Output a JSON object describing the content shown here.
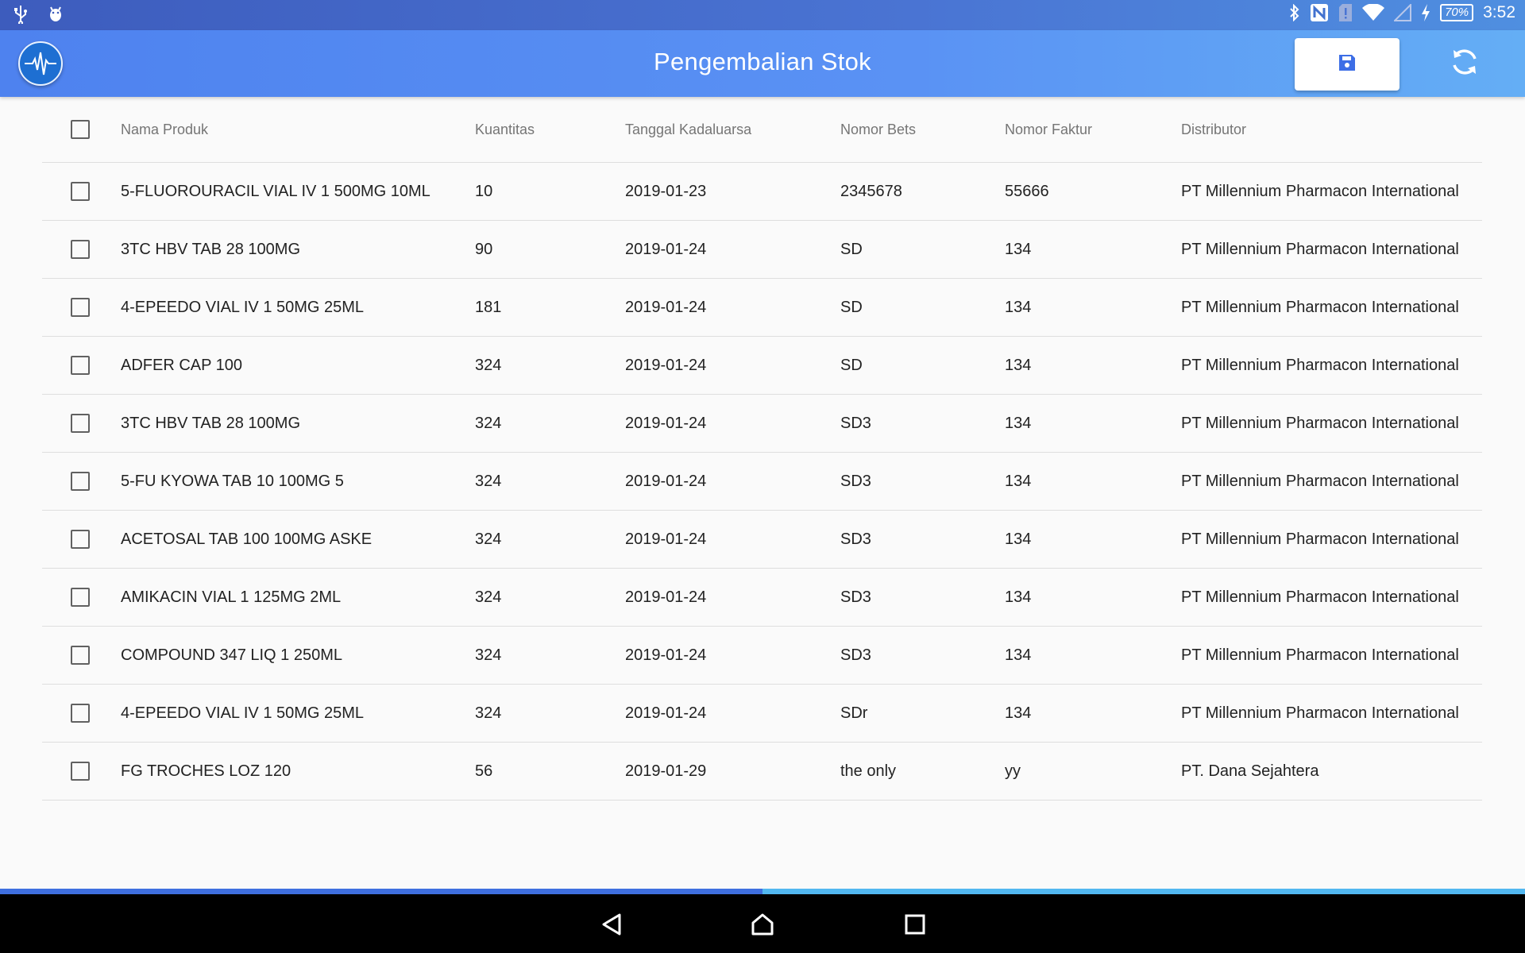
{
  "status_bar": {
    "time": "3:52",
    "battery": "70%",
    "left_icons": [
      "usb-icon",
      "android-debug-icon"
    ],
    "right_icons": [
      "bluetooth-icon",
      "nfc-icon",
      "sim-alert-icon",
      "wifi-icon",
      "signal-icon",
      "charging-icon"
    ]
  },
  "app_bar": {
    "title": "Pengembalian Stok",
    "logo_icon": "heartbeat-icon",
    "save_icon": "floppy-disk-icon",
    "sync_icon": "sync-icon"
  },
  "table": {
    "columns": [
      "Nama Produk",
      "Kuantitas",
      "Tanggal Kadaluarsa",
      "Nomor Bets",
      "Nomor Faktur",
      "Distributor"
    ],
    "rows": [
      {
        "name": "5-FLUOROURACIL VIAL IV 1 500MG 10ML",
        "qty": "10",
        "date": "2019-01-23",
        "bets": "2345678",
        "faktur": "55666",
        "dist": "PT Millennium Pharmacon International",
        "checked": false
      },
      {
        "name": "3TC HBV TAB 28 100MG",
        "qty": "90",
        "date": "2019-01-24",
        "bets": "SD",
        "faktur": "134",
        "dist": "PT Millennium Pharmacon International",
        "checked": false
      },
      {
        "name": "4-EPEEDO VIAL IV 1 50MG 25ML",
        "qty": "181",
        "date": "2019-01-24",
        "bets": "SD",
        "faktur": "134",
        "dist": "PT Millennium Pharmacon International",
        "checked": false
      },
      {
        "name": "ADFER CAP 100",
        "qty": "324",
        "date": "2019-01-24",
        "bets": "SD",
        "faktur": "134",
        "dist": "PT Millennium Pharmacon International",
        "checked": false
      },
      {
        "name": "3TC HBV TAB 28 100MG",
        "qty": "324",
        "date": "2019-01-24",
        "bets": "SD3",
        "faktur": "134",
        "dist": "PT Millennium Pharmacon International",
        "checked": false
      },
      {
        "name": "5-FU KYOWA TAB 10 100MG 5",
        "qty": "324",
        "date": "2019-01-24",
        "bets": "SD3",
        "faktur": "134",
        "dist": "PT Millennium Pharmacon International",
        "checked": false
      },
      {
        "name": "ACETOSAL TAB 100 100MG ASKE",
        "qty": "324",
        "date": "2019-01-24",
        "bets": "SD3",
        "faktur": "134",
        "dist": "PT Millennium Pharmacon International",
        "checked": false
      },
      {
        "name": "AMIKACIN VIAL 1 125MG 2ML",
        "qty": "324",
        "date": "2019-01-24",
        "bets": "SD3",
        "faktur": "134",
        "dist": "PT Millennium Pharmacon International",
        "checked": false
      },
      {
        "name": "COMPOUND 347 LIQ 1 250ML",
        "qty": "324",
        "date": "2019-01-24",
        "bets": "SD3",
        "faktur": "134",
        "dist": "PT Millennium Pharmacon International",
        "checked": false
      },
      {
        "name": "4-EPEEDO VIAL IV 1 50MG 25ML",
        "qty": "324",
        "date": "2019-01-24",
        "bets": "SDr",
        "faktur": "134",
        "dist": "PT Millennium Pharmacon International",
        "checked": false
      },
      {
        "name": "FG TROCHES LOZ 120",
        "qty": "56",
        "date": "2019-01-29",
        "bets": "the only",
        "faktur": "yy",
        "dist": "PT. Dana Sejahtera",
        "checked": false
      }
    ]
  },
  "progress": {
    "value": 0.5
  },
  "nav_bar": {
    "icons": [
      "back-icon",
      "home-icon",
      "recents-icon"
    ]
  },
  "colors": {
    "accent": "#4e82ef",
    "progress_fill": "#3f6fdf",
    "progress_track": "#52b8f0"
  }
}
